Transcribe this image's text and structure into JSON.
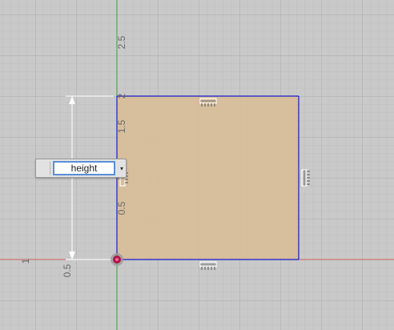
{
  "axis_ticks": {
    "vertical": [
      "2.5",
      "2",
      "1.5",
      "1",
      "0.5"
    ],
    "dimension_left": [
      "1",
      "0.5"
    ]
  },
  "dimension_input": {
    "value": "height",
    "dropdown_glyph": "▾"
  },
  "colors": {
    "background": "#c9c9c9",
    "rectangle_fill": "#d9bc94",
    "rectangle_edge": "#1a1acc",
    "x_axis": "#d06060",
    "y_axis": "#3ea03e",
    "origin_point": "#b0144a"
  },
  "icons": {
    "constraint": "horizontal-vertical-constraint-icon",
    "origin": "origin-point-icon",
    "dropdown": "chevron-down-icon"
  }
}
